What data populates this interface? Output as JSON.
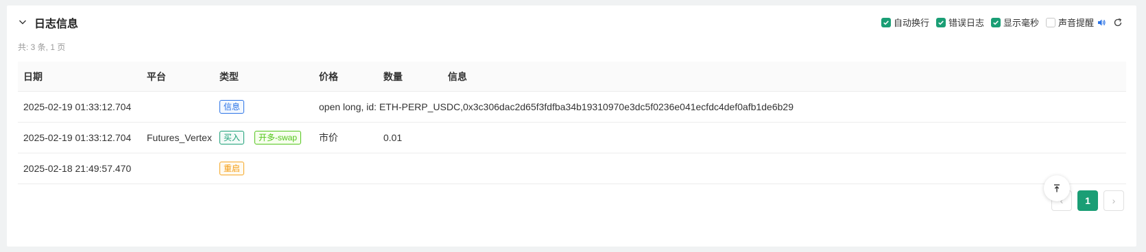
{
  "panel": {
    "title": "日志信息",
    "summary": "共: 3 条, 1 页"
  },
  "controls": {
    "auto_wrap": {
      "label": "自动换行",
      "checked": true
    },
    "error_log": {
      "label": "错误日志",
      "checked": true
    },
    "show_ms": {
      "label": "显示毫秒",
      "checked": true
    },
    "sound_alert": {
      "label": "声音提醒",
      "checked": false
    }
  },
  "columns": {
    "date": "日期",
    "platform": "平台",
    "type": "类型",
    "price": "价格",
    "quantity": "数量",
    "info": "信息"
  },
  "rows": [
    {
      "date": "2025-02-19 01:33:12.704",
      "platform": "",
      "tag": "信息",
      "tag2": "",
      "price": "open long, id: ETH-PERP_USDC,0x3c306dac2d65f3fdfba34b19310970e3dc5f0236e041ecfdc4def0afb1de6b29",
      "quantity": "",
      "info": ""
    },
    {
      "date": "2025-02-19 01:33:12.704",
      "platform": "Futures_Vertex",
      "tag": "买入",
      "tag2": "开多-swap",
      "price": "市价",
      "quantity": "0.01",
      "info": ""
    },
    {
      "date": "2025-02-18 21:49:57.470",
      "platform": "",
      "tag": "重启",
      "tag2": "",
      "price": "",
      "quantity": "",
      "info": ""
    }
  ],
  "pagination": {
    "prev": "‹",
    "current": "1",
    "next": "›"
  },
  "colors": {
    "accent": "#1a9e75",
    "tag_info": "#2b73e6",
    "tag_buy": "#1a9e75",
    "tag_open_long": "#52c41a",
    "tag_restart": "#f39c12",
    "sound_icon": "#2b73e6"
  },
  "icons": {
    "collapse": "chevron-down-icon",
    "sound": "speaker-icon",
    "refresh": "refresh-icon",
    "back_to_top": "arrow-up-to-line-icon"
  }
}
